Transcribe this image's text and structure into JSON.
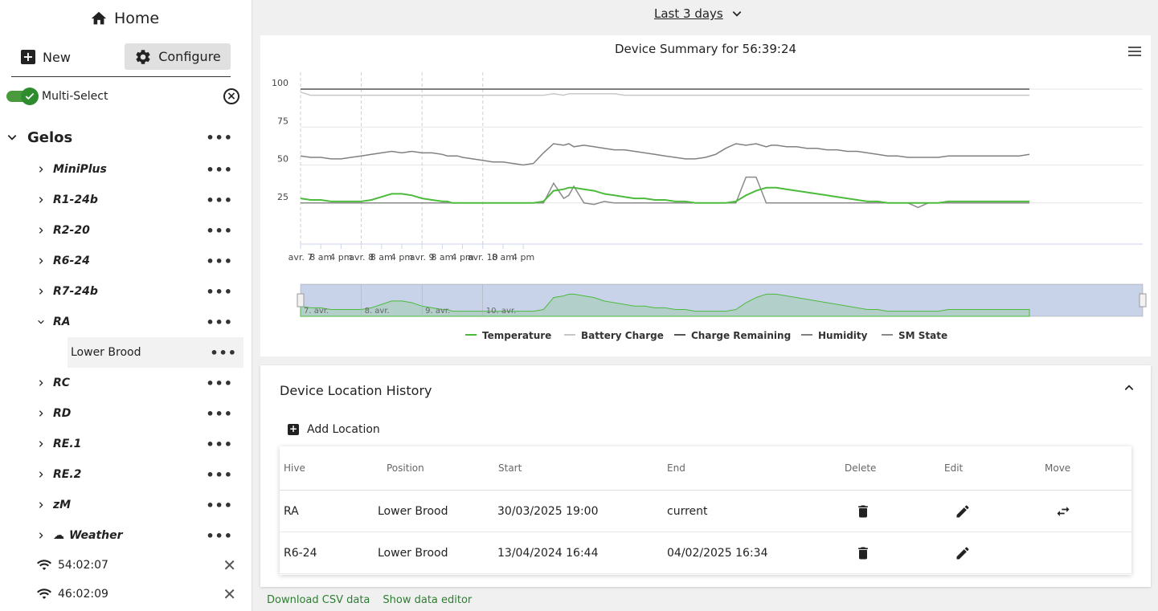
{
  "sidebar": {
    "home_label": "Home",
    "new_label": "New",
    "configure_label": "Configure",
    "multiselect_label": "Multi-Select",
    "multiselect_on": true,
    "group_label": "Gelos",
    "items": [
      {
        "label": "MiniPlus"
      },
      {
        "label": "R1-24b"
      },
      {
        "label": "R2-20"
      },
      {
        "label": "R6-24"
      },
      {
        "label": "R7-24b"
      },
      {
        "label": "RA",
        "expanded": true
      },
      {
        "label": "Lower Brood",
        "child": true
      },
      {
        "label": "RC"
      },
      {
        "label": "RD"
      },
      {
        "label": "RE.1"
      },
      {
        "label": "RE.2"
      },
      {
        "label": "zM"
      },
      {
        "label": "Weather",
        "icon": "weather-icon"
      }
    ],
    "devices": [
      {
        "label": "54:02:07"
      },
      {
        "label": "46:02:09"
      }
    ]
  },
  "range_label": "Last 3 days",
  "chart_data": {
    "type": "line",
    "title": "Device Summary for 56:39:24",
    "y_ticks": [
      "100",
      "75",
      "50",
      "25"
    ],
    "ylim": [
      0,
      100
    ],
    "x_ticks": [
      "avr. 7",
      "8 am",
      "4 pm",
      "avr. 8",
      "8 am",
      "4 pm",
      "avr. 9",
      "8 am",
      "4 pm",
      "avr. 10",
      "8 am",
      "4 pm"
    ],
    "navigator_labels": [
      "7. avr.",
      "8. avr.",
      "9. avr.",
      "10. avr."
    ],
    "legend": [
      {
        "name": "Temperature",
        "color": "#4cbb3c"
      },
      {
        "name": "Battery Charge",
        "color": "#c8c8c8"
      },
      {
        "name": "Charge Remaining",
        "color": "#555555"
      },
      {
        "name": "Humidity",
        "color": "#808080"
      },
      {
        "name": "SM State",
        "color": "#8a8a8a"
      }
    ],
    "x": [
      0,
      4,
      8,
      12,
      16,
      20,
      24,
      28,
      32,
      36,
      40,
      44,
      48,
      52,
      56,
      58,
      60,
      62,
      64,
      68,
      72,
      76,
      80,
      84,
      88,
      92,
      96,
      100,
      104,
      106,
      108,
      112,
      116,
      120,
      124,
      128,
      132,
      136,
      140,
      144,
      148,
      152,
      156,
      160,
      164,
      168,
      172,
      176,
      180,
      184,
      186,
      188,
      192,
      196,
      200,
      204,
      208,
      212,
      216,
      220,
      224,
      228,
      232,
      236,
      240,
      244,
      248,
      252,
      256,
      260,
      264,
      268,
      272,
      276,
      280,
      284,
      288
    ],
    "series": [
      {
        "name": "Temperature",
        "color": "#4cbb3c",
        "values": [
          28,
          27,
          27,
          26,
          26,
          26,
          26,
          27,
          29,
          31,
          31,
          30,
          28,
          27,
          26,
          26,
          25,
          25,
          25,
          25,
          25,
          25,
          25,
          25,
          25,
          25,
          26,
          33,
          34,
          35,
          35,
          34,
          33,
          31,
          30,
          29,
          28,
          28,
          27,
          27,
          26,
          26,
          25,
          25,
          25,
          25,
          26,
          30,
          33,
          35,
          35,
          35,
          34,
          33,
          32,
          31,
          30,
          29,
          28,
          27,
          26,
          26,
          25,
          25,
          25,
          25,
          25,
          25,
          26,
          26,
          26,
          26,
          26,
          26,
          26,
          26,
          26
        ]
      },
      {
        "name": "Battery Charge",
        "color": "#c8c8c8",
        "values": [
          98,
          96,
          96,
          96,
          96,
          96,
          96,
          96,
          96,
          96,
          96,
          96,
          96,
          96,
          96,
          96,
          96,
          96,
          96,
          96,
          96,
          96,
          96,
          96,
          96,
          96,
          96,
          97,
          96,
          97,
          97,
          97,
          97,
          97,
          97,
          96,
          96,
          96,
          96,
          96,
          96,
          96,
          96,
          96,
          96,
          96,
          96,
          96,
          96,
          96,
          96,
          96,
          96,
          96,
          96,
          96,
          96,
          96,
          96,
          96,
          96,
          96,
          96,
          96,
          96,
          96,
          96,
          96,
          96,
          96,
          96,
          96,
          96,
          96,
          96,
          96,
          96
        ]
      },
      {
        "name": "Charge Remaining",
        "color": "#555555",
        "values": [
          100,
          100,
          100,
          100,
          100,
          100,
          100,
          100,
          100,
          100,
          100,
          100,
          100,
          100,
          100,
          100,
          100,
          100,
          100,
          100,
          100,
          100,
          100,
          100,
          100,
          100,
          100,
          100,
          100,
          100,
          100,
          100,
          100,
          100,
          100,
          100,
          100,
          100,
          100,
          100,
          100,
          100,
          100,
          100,
          100,
          100,
          100,
          100,
          100,
          100,
          100,
          100,
          100,
          100,
          100,
          100,
          100,
          100,
          100,
          100,
          100,
          100,
          100,
          100,
          100,
          100,
          100,
          100,
          100,
          100,
          100,
          100,
          100,
          100,
          100,
          100,
          100
        ]
      },
      {
        "name": "Humidity",
        "color": "#808080",
        "values": [
          56,
          55,
          55,
          54,
          54,
          55,
          56,
          57,
          58,
          59,
          58,
          59,
          58,
          58,
          57,
          56,
          56,
          56,
          55,
          54,
          53,
          52,
          52,
          51,
          50,
          51,
          58,
          64,
          63,
          64,
          62,
          63,
          62,
          61,
          60,
          60,
          59,
          58,
          57,
          56,
          55,
          54,
          54,
          55,
          57,
          61,
          64,
          63,
          64,
          62,
          63,
          63,
          62,
          62,
          61,
          61,
          60,
          60,
          59,
          59,
          58,
          57,
          56,
          56,
          55,
          55,
          55,
          55,
          56,
          56,
          56,
          56,
          56,
          56,
          56,
          56,
          57
        ]
      },
      {
        "name": "SM State",
        "color": "#8a8a8a",
        "values": [
          25,
          25,
          25,
          25,
          25,
          25,
          25,
          25,
          25,
          25,
          25,
          25,
          25,
          25,
          25,
          25,
          25,
          25,
          25,
          25,
          25,
          25,
          25,
          25,
          25,
          25,
          25,
          38,
          28,
          30,
          36,
          25,
          24,
          26,
          25,
          25,
          25,
          25,
          25,
          25,
          25,
          25,
          25,
          25,
          25,
          25,
          25,
          42,
          42,
          25,
          25,
          25,
          25,
          25,
          25,
          25,
          25,
          25,
          25,
          25,
          25,
          25,
          25,
          25,
          25,
          22,
          25,
          25,
          25,
          25,
          25,
          25,
          25,
          25,
          25,
          25,
          25
        ]
      }
    ]
  },
  "location_history": {
    "title": "Device Location History",
    "add_label": "Add Location",
    "columns": [
      "Hive",
      "Position",
      "Start",
      "End",
      "Delete",
      "Edit",
      "Move"
    ],
    "rows": [
      {
        "hive": "RA",
        "position": "Lower Brood",
        "start": "30/03/2025 19:00",
        "end": "current",
        "move": true
      },
      {
        "hive": "R6-24",
        "position": "Lower Brood",
        "start": "13/04/2024 16:44",
        "end": "04/02/2025 16:34",
        "move": false
      }
    ]
  },
  "footer": {
    "csv_label": "Download CSV data",
    "editor_label": "Show data editor"
  }
}
